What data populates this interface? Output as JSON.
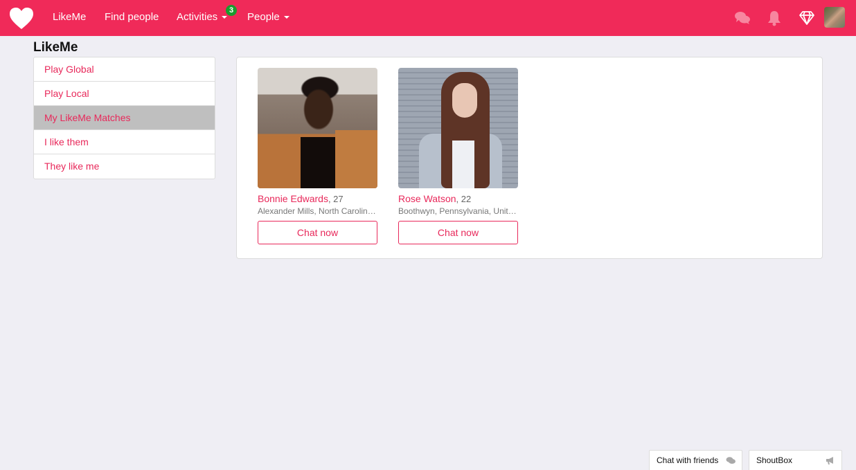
{
  "navbar": {
    "brand_icon": "heart-icon",
    "links": [
      {
        "label": "LikeMe"
      },
      {
        "label": "Find people"
      },
      {
        "label": "Activities",
        "badge": "3",
        "has_dropdown": true
      },
      {
        "label": "People",
        "has_dropdown": true
      }
    ],
    "right_icons": [
      "chat-bubbles-icon",
      "bell-icon",
      "diamond-icon",
      "user-avatar"
    ],
    "accent_color": "#f02a59",
    "badge_color": "#1a9c2e"
  },
  "sidebar": {
    "title": "LikeMe",
    "items": [
      {
        "label": "Play Global",
        "active": false
      },
      {
        "label": "Play Local",
        "active": false
      },
      {
        "label": "My LikeMe Matches",
        "active": true
      },
      {
        "label": "I like them",
        "active": false
      },
      {
        "label": "They like me",
        "active": false
      }
    ]
  },
  "matches": [
    {
      "name": "Bonnie Edwards",
      "age": ", 27",
      "location": "Alexander Mills, North Carolin…",
      "button": "Chat now"
    },
    {
      "name": "Rose Watson",
      "age": ", 22",
      "location": "Boothwyn, Pennsylvania, Unit…",
      "button": "Chat now"
    }
  ],
  "dock": {
    "chat_label": "Chat with friends",
    "shoutbox_label": "ShoutBox"
  }
}
